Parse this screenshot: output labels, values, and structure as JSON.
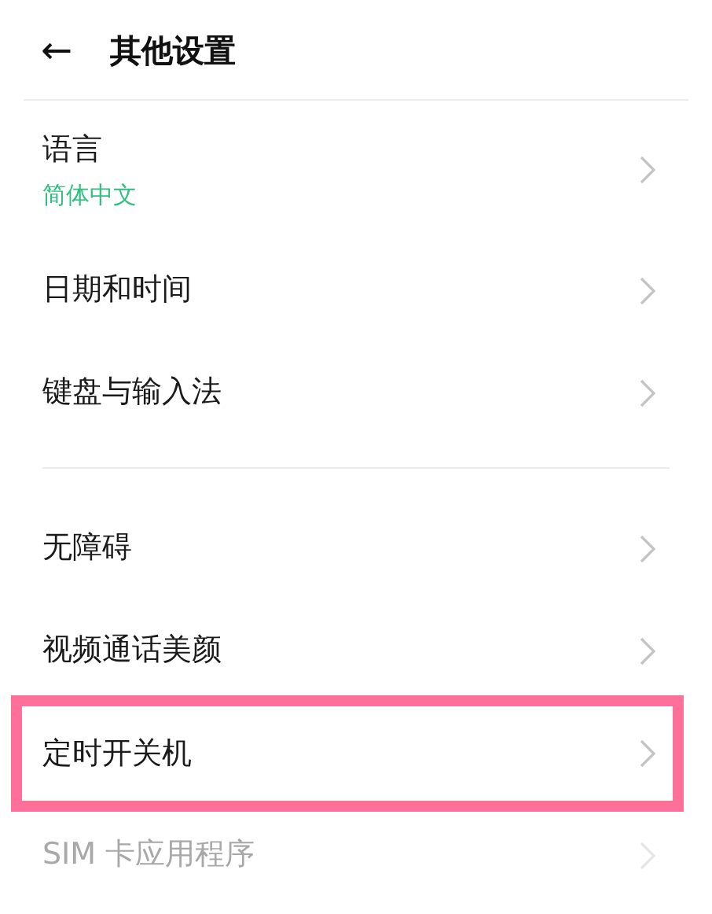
{
  "header": {
    "back": "←",
    "title": "其他设置"
  },
  "groups": [
    {
      "items": [
        {
          "label": "语言",
          "value": "简体中文",
          "disabled": false,
          "highlighted": false
        },
        {
          "label": "日期和时间",
          "disabled": false,
          "highlighted": false
        },
        {
          "label": "键盘与输入法",
          "disabled": false,
          "highlighted": false
        }
      ]
    },
    {
      "items": [
        {
          "label": "无障碍",
          "disabled": false,
          "highlighted": false
        },
        {
          "label": "视频通话美颜",
          "disabled": false,
          "highlighted": false
        },
        {
          "label": "定时开关机",
          "disabled": false,
          "highlighted": true
        },
        {
          "label": "SIM 卡应用程序",
          "disabled": true,
          "highlighted": false
        }
      ]
    }
  ]
}
